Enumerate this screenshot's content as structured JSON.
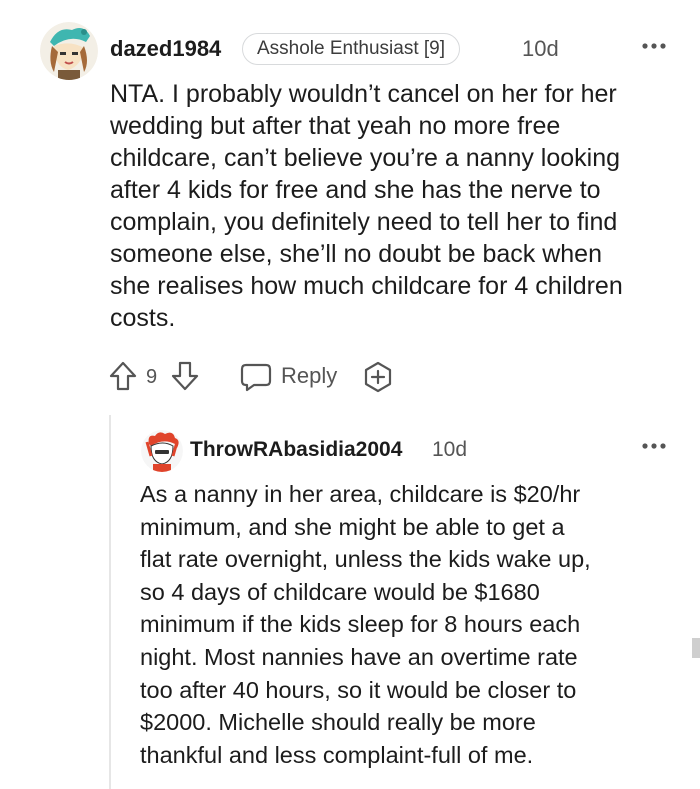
{
  "comment": {
    "username": "dazed1984",
    "flair": "Asshole Enthusiast [9]",
    "time": "10d",
    "more_icon": "more-horizontal-icon",
    "body": "NTA. I probably wouldn’t cancel on her for her\nwedding but after that yeah no more free\nchildcare, can’t believe you’re a nanny looking\nafter 4 kids for free and she has the nerve to\ncomplain, you definitely need to tell her to find\nsomeone else, she’ll no doubt be back when\nshe realises how much childcare for 4 children\ncosts.",
    "score": "9",
    "reply_label": "Reply",
    "icons": {
      "upvote": "upvote-arrow-icon",
      "downvote": "downvote-arrow-icon",
      "reply": "reply-bubble-icon",
      "award": "award-plus-icon"
    }
  },
  "reply": {
    "username": "ThrowRAbasidia2004",
    "time": "10d",
    "more_icon": "more-horizontal-icon",
    "body": "As a nanny in her area, childcare is $20/hr\nminimum, and she might be able to get a\nflat rate overnight, unless the kids wake up,\nso 4 days of childcare would be $1680\nminimum if the kids sleep for 8 hours each\nnight. Most nannies have an overtime rate\ntoo after 40 hours, so it would be closer to\n$2000. Michelle should really be more\nthankful and less complaint-full of me."
  },
  "colors": {
    "text": "#1c1c1c",
    "muted": "#555555",
    "flair_border": "#d8dadc",
    "thread_line": "#e6e6e6",
    "avatar_teal": "#3fb6b0",
    "avatar_red": "#e0442b"
  }
}
